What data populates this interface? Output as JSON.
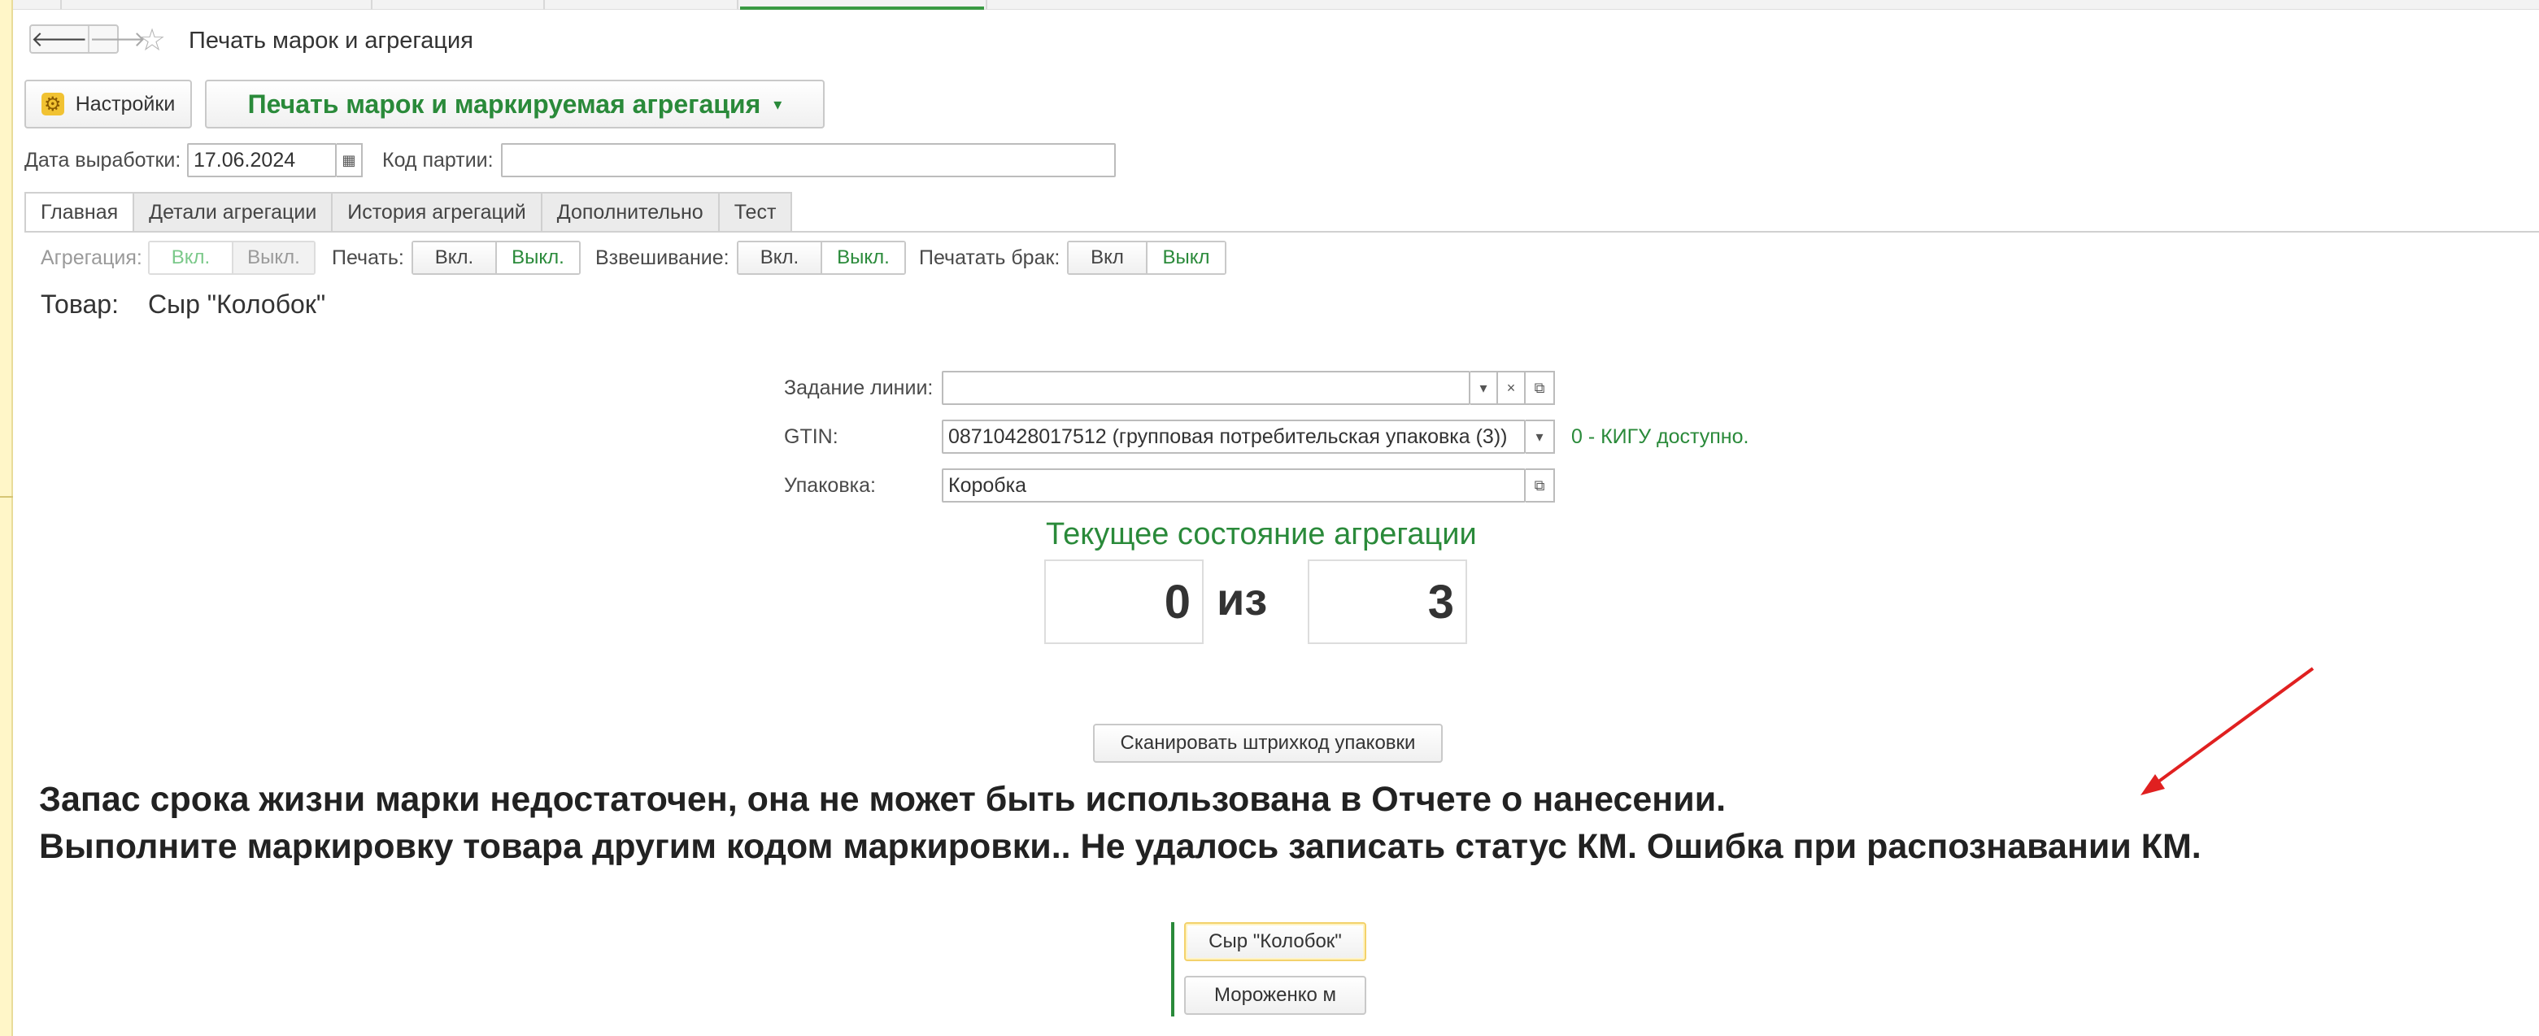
{
  "window": {
    "title": "Печать марок и агрегация",
    "nav_back": "🡐",
    "nav_forward": "🡒",
    "favorite_icon": "☆"
  },
  "toolbar": {
    "settings_label": "Настройки",
    "mode_label": "Печать марок и маркируемая агрегация",
    "mode_dropdown_icon": "▾"
  },
  "header_fields": {
    "production_date_label": "Дата выработки:",
    "production_date_value": "17.06.2024",
    "batch_code_label": "Код партии:",
    "batch_code_value": ""
  },
  "tabs": [
    {
      "label": "Главная",
      "active": true
    },
    {
      "label": "Детали агрегации",
      "active": false
    },
    {
      "label": "История агрегаций",
      "active": false
    },
    {
      "label": "Дополнительно",
      "active": false
    },
    {
      "label": "Тест",
      "active": false
    }
  ],
  "toggles": {
    "aggregation": {
      "label": "Агрегация:",
      "on": "Вкл.",
      "off": "Выкл."
    },
    "print": {
      "label": "Печать:",
      "on": "Вкл.",
      "off": "Выкл."
    },
    "weighing": {
      "label": "Взвешивание:",
      "on": "Вкл.",
      "off": "Выкл."
    },
    "print_defect": {
      "label": "Печатать брак:",
      "on": "Вкл",
      "off": "Выкл"
    }
  },
  "product": {
    "label": "Товар:",
    "value": "Сыр \"Колобок\""
  },
  "line_form": {
    "task_label": "Задание линии:",
    "task_value": "",
    "gtin_label": "GTIN:",
    "gtin_value": "08710428017512 (групповая потребительская упаковка (3))",
    "gtin_status": "0 - КИГУ доступно.",
    "package_label": "Упаковка:",
    "package_value": "Коробка"
  },
  "aggregation_state": {
    "title": "Текущее состояние агрегации",
    "current": "0",
    "separator": "из",
    "total": "3"
  },
  "scan_button_label": "Сканировать штрихкод упаковки",
  "error_message": {
    "line1": "Запас срока жизни марки недостаточен, она не может быть использована в Отчете о нанесении.",
    "line2": "Выполните маркировку товара другим кодом маркировки.. Не удалось записать статус КМ. Ошибка при распознавании КМ."
  },
  "product_buttons": [
    {
      "label": "Сыр \"Колобок\"",
      "selected": true
    },
    {
      "label": "Мороженко м",
      "selected": false
    }
  ],
  "colors": {
    "accent_green": "#2a8a3a",
    "annotation_arrow": "#e02020"
  }
}
